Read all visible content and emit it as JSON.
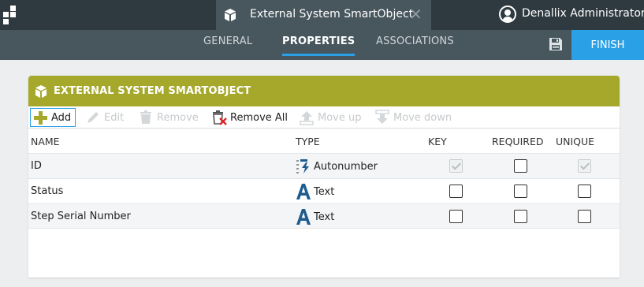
{
  "app": {
    "document_tab_title": "External System SmartObject",
    "user_name": "Denallix Administrator"
  },
  "nav": {
    "tabs": [
      {
        "label": "GENERAL",
        "active": false
      },
      {
        "label": "PROPERTIES",
        "active": true
      },
      {
        "label": "ASSOCIATIONS",
        "active": false
      }
    ],
    "finish_label": "FINISH"
  },
  "panel": {
    "title": "EXTERNAL SYSTEM SMARTOBJECT",
    "toolbar": {
      "add": "Add",
      "edit": "Edit",
      "remove": "Remove",
      "remove_all": "Remove All",
      "move_up": "Move up",
      "move_down": "Move down"
    },
    "columns": [
      "NAME",
      "TYPE",
      "KEY",
      "REQUIRED",
      "UNIQUE"
    ],
    "rows": [
      {
        "name": "ID",
        "type": "Autonumber",
        "type_icon": "autonumber-icon",
        "key": true,
        "key_disabled": true,
        "required": false,
        "unique": true,
        "unique_disabled": true
      },
      {
        "name": "Status",
        "type": "Text",
        "type_icon": "text-type-icon",
        "key": false,
        "required": false,
        "unique": false
      },
      {
        "name": "Step Serial Number",
        "type": "Text",
        "type_icon": "text-type-icon",
        "key": false,
        "required": false,
        "unique": false
      }
    ]
  },
  "colors": {
    "topbar": "#2f3a40",
    "navbar": "#48565e",
    "accent": "#2aa0e6",
    "panel_header": "#a6a82b"
  }
}
